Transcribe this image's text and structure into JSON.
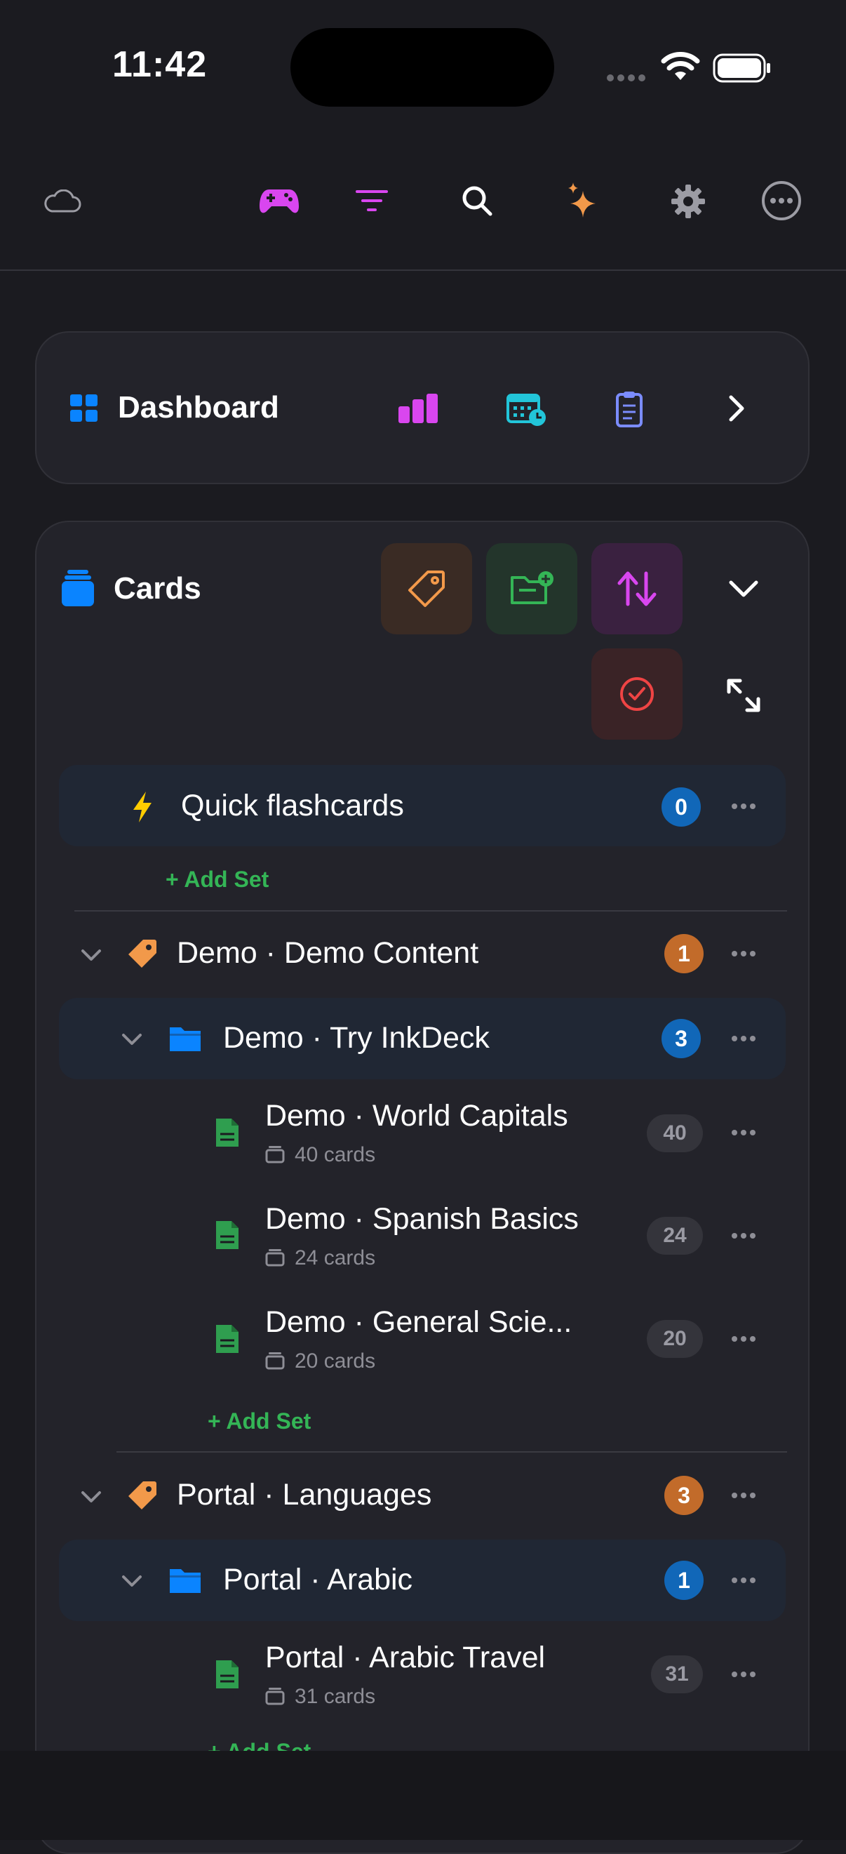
{
  "status_bar": {
    "time": "11:42"
  },
  "toolbar": {
    "icons": [
      "cloud-icon",
      "gamepad-icon",
      "filter-icon",
      "search-icon",
      "sparkles-icon",
      "gear-icon",
      "more-circle-icon"
    ]
  },
  "dashboard": {
    "title": "Dashboard"
  },
  "cards": {
    "title": "Cards",
    "quick": {
      "title": "Quick flashcards",
      "badge": "0"
    },
    "add_set_label": "+ Add Set",
    "groups": [
      {
        "title": "Demo · Demo Content",
        "badge": "1",
        "folder": {
          "title": "Demo · Try InkDeck",
          "badge": "3"
        },
        "sets": [
          {
            "title": "Demo · World Capitals",
            "sub": "40 cards",
            "count": "40"
          },
          {
            "title": "Demo · Spanish Basics",
            "sub": "24 cards",
            "count": "24"
          },
          {
            "title": "Demo · General Scie...",
            "sub": "20 cards",
            "count": "20"
          }
        ]
      },
      {
        "title": "Portal · Languages",
        "badge": "3",
        "folder": {
          "title": "Portal · Arabic",
          "badge": "1"
        },
        "sets": [
          {
            "title": "Portal · Arabic Travel",
            "sub": "31 cards",
            "count": "31"
          }
        ]
      }
    ]
  },
  "colors": {
    "background": "#1b1b20",
    "panel": "#23232a",
    "accent_blue": "#0a84ff",
    "accent_orange": "#f2994a",
    "accent_green": "#34b556",
    "accent_magenta": "#e040fb",
    "badge_blue": "#1167b8",
    "badge_orange": "#c26b2a"
  }
}
